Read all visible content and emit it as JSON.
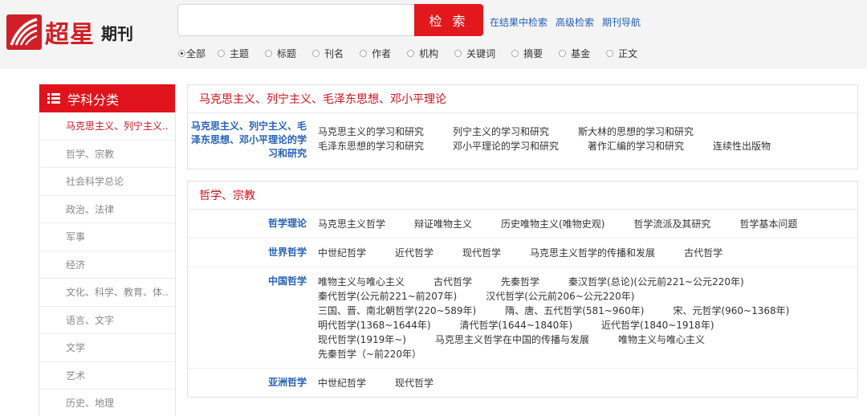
{
  "logo": {
    "brand": "超星",
    "product": "期刊"
  },
  "search": {
    "value": "",
    "button": "检 索"
  },
  "top_links": [
    "在结果中检索",
    "高级检索",
    "期刊导航"
  ],
  "search_fields": [
    {
      "label": "全部",
      "checked": true
    },
    {
      "label": "主题",
      "checked": false
    },
    {
      "label": "标题",
      "checked": false
    },
    {
      "label": "刊名",
      "checked": false
    },
    {
      "label": "作者",
      "checked": false
    },
    {
      "label": "机构",
      "checked": false
    },
    {
      "label": "关键词",
      "checked": false
    },
    {
      "label": "摘要",
      "checked": false
    },
    {
      "label": "基金",
      "checked": false
    },
    {
      "label": "正文",
      "checked": false
    }
  ],
  "sidebar": {
    "title": "学科分类",
    "items": [
      "马克思主义、列宁主义..",
      "哲学、宗教",
      "社会科学总论",
      "政治、法律",
      "军事",
      "经济",
      "文化、科学、教育、体..",
      "语言、文字",
      "文学",
      "艺术",
      "历史、地理"
    ]
  },
  "sections": [
    {
      "title": "马克思主义、列宁主义、毛泽东思想、邓小平理论",
      "rows": [
        {
          "head": "马克思主义、列宁主义、毛泽东思想、邓小平理论的学习和研究",
          "lines": [
            [
              "马克思主义的学习和研究",
              "列宁主义的学习和研究",
              "斯大林的思想的学习和研究"
            ],
            [
              "毛泽东思想的学习和研究",
              "邓小平理论的学习和研究",
              "著作汇编的学习和研究",
              "连续性出版物"
            ]
          ]
        }
      ]
    },
    {
      "title": "哲学、宗教",
      "rows": [
        {
          "head": "哲学理论",
          "lines": [
            [
              "马克思主义哲学",
              "辩证唯物主义",
              "历史唯物主义(唯物史观)",
              "哲学流派及其研究",
              "哲学基本问题"
            ]
          ]
        },
        {
          "head": "世界哲学",
          "lines": [
            [
              "中世纪哲学",
              "近代哲学",
              "现代哲学",
              "马克思主义哲学的传播和发展",
              "古代哲学"
            ]
          ]
        },
        {
          "head": "中国哲学",
          "lines": [
            [
              "唯物主义与唯心主义",
              "古代哲学",
              "先秦哲学",
              "秦汉哲学(总论)(公元前221~公元220年)"
            ],
            [
              "秦代哲学(公元前221~前207年)",
              "汉代哲学(公元前206~公元220年)"
            ],
            [
              "三国、晋、南北朝哲学(220~589年)",
              "隋、唐、五代哲学(581~960年)",
              "宋、元哲学(960~1368年)"
            ],
            [
              "明代哲学(1368~1644年)",
              "清代哲学(1644~1840年)",
              "近代哲学(1840~1918年)"
            ],
            [
              "现代哲学(1919年~)",
              "马克思主义哲学在中国的传播与发展",
              "唯物主义与唯心主义"
            ],
            [
              "先秦哲学（~前220年）"
            ]
          ]
        },
        {
          "head": "亚洲哲学",
          "lines": [
            [
              "中世纪哲学",
              "现代哲学"
            ]
          ]
        }
      ]
    }
  ]
}
